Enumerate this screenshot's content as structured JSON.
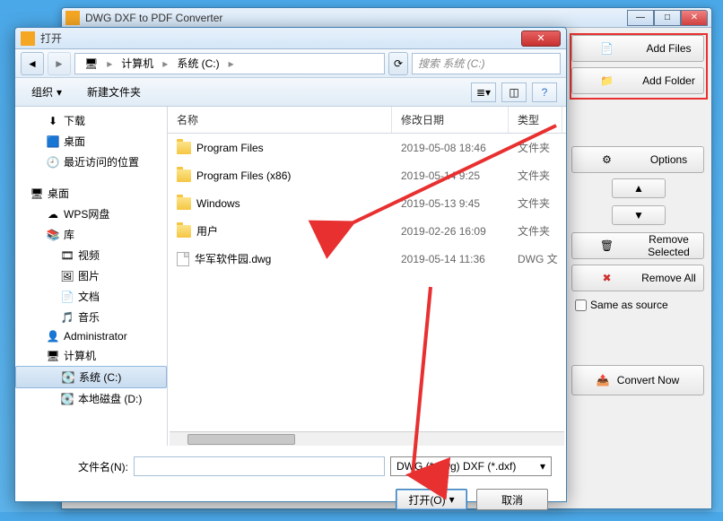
{
  "main": {
    "title": "DWG DXF to PDF Converter"
  },
  "side": {
    "add_files": "Add Files",
    "add_folder": "Add Folder",
    "options": "Options",
    "remove_selected": "Remove Selected",
    "remove_all": "Remove All",
    "same_as_source": "Same as source",
    "convert_now": "Convert Now"
  },
  "dialog": {
    "title": "打开",
    "breadcrumb": {
      "root": "计算机",
      "drive": "系统 (C:)"
    },
    "search_placeholder": "搜索 系统 (C:)",
    "toolbar": {
      "organize": "组织",
      "new_folder": "新建文件夹"
    },
    "columns": {
      "name": "名称",
      "date": "修改日期",
      "type": "类型"
    },
    "tree": [
      {
        "label": "下载",
        "icon": "download",
        "indent": 24
      },
      {
        "label": "桌面",
        "icon": "desktop",
        "indent": 24
      },
      {
        "label": "最近访问的位置",
        "icon": "recent",
        "indent": 24
      },
      {
        "label": "",
        "spacer": true
      },
      {
        "label": "桌面",
        "icon": "desktop-root",
        "indent": 6,
        "bold": true
      },
      {
        "label": "WPS网盘",
        "icon": "cloud",
        "indent": 24
      },
      {
        "label": "库",
        "icon": "library",
        "indent": 24
      },
      {
        "label": "视频",
        "icon": "video",
        "indent": 40
      },
      {
        "label": "图片",
        "icon": "image",
        "indent": 40
      },
      {
        "label": "文档",
        "icon": "doc",
        "indent": 40
      },
      {
        "label": "音乐",
        "icon": "music",
        "indent": 40
      },
      {
        "label": "Administrator",
        "icon": "user",
        "indent": 24
      },
      {
        "label": "计算机",
        "icon": "computer",
        "indent": 24
      },
      {
        "label": "系统 (C:)",
        "icon": "drive",
        "indent": 40,
        "selected": true
      },
      {
        "label": "本地磁盘 (D:)",
        "icon": "drive",
        "indent": 40
      }
    ],
    "files": [
      {
        "name": "Program Files",
        "date": "2019-05-08 18:46",
        "type": "文件夹",
        "kind": "folder"
      },
      {
        "name": "Program Files (x86)",
        "date": "2019-05-14 9:25",
        "type": "文件夹",
        "kind": "folder"
      },
      {
        "name": "Windows",
        "date": "2019-05-13 9:45",
        "type": "文件夹",
        "kind": "folder"
      },
      {
        "name": "用户",
        "date": "2019-02-26 16:09",
        "type": "文件夹",
        "kind": "folder"
      },
      {
        "name": "华军软件园.dwg",
        "date": "2019-05-14 11:36",
        "type": "DWG 文",
        "kind": "file"
      }
    ],
    "filename_label": "文件名(N):",
    "filename_value": "",
    "filetype": "DWG (*.dwg) DXF (*.dxf)",
    "open_btn": "打开(O)",
    "cancel_btn": "取消"
  }
}
